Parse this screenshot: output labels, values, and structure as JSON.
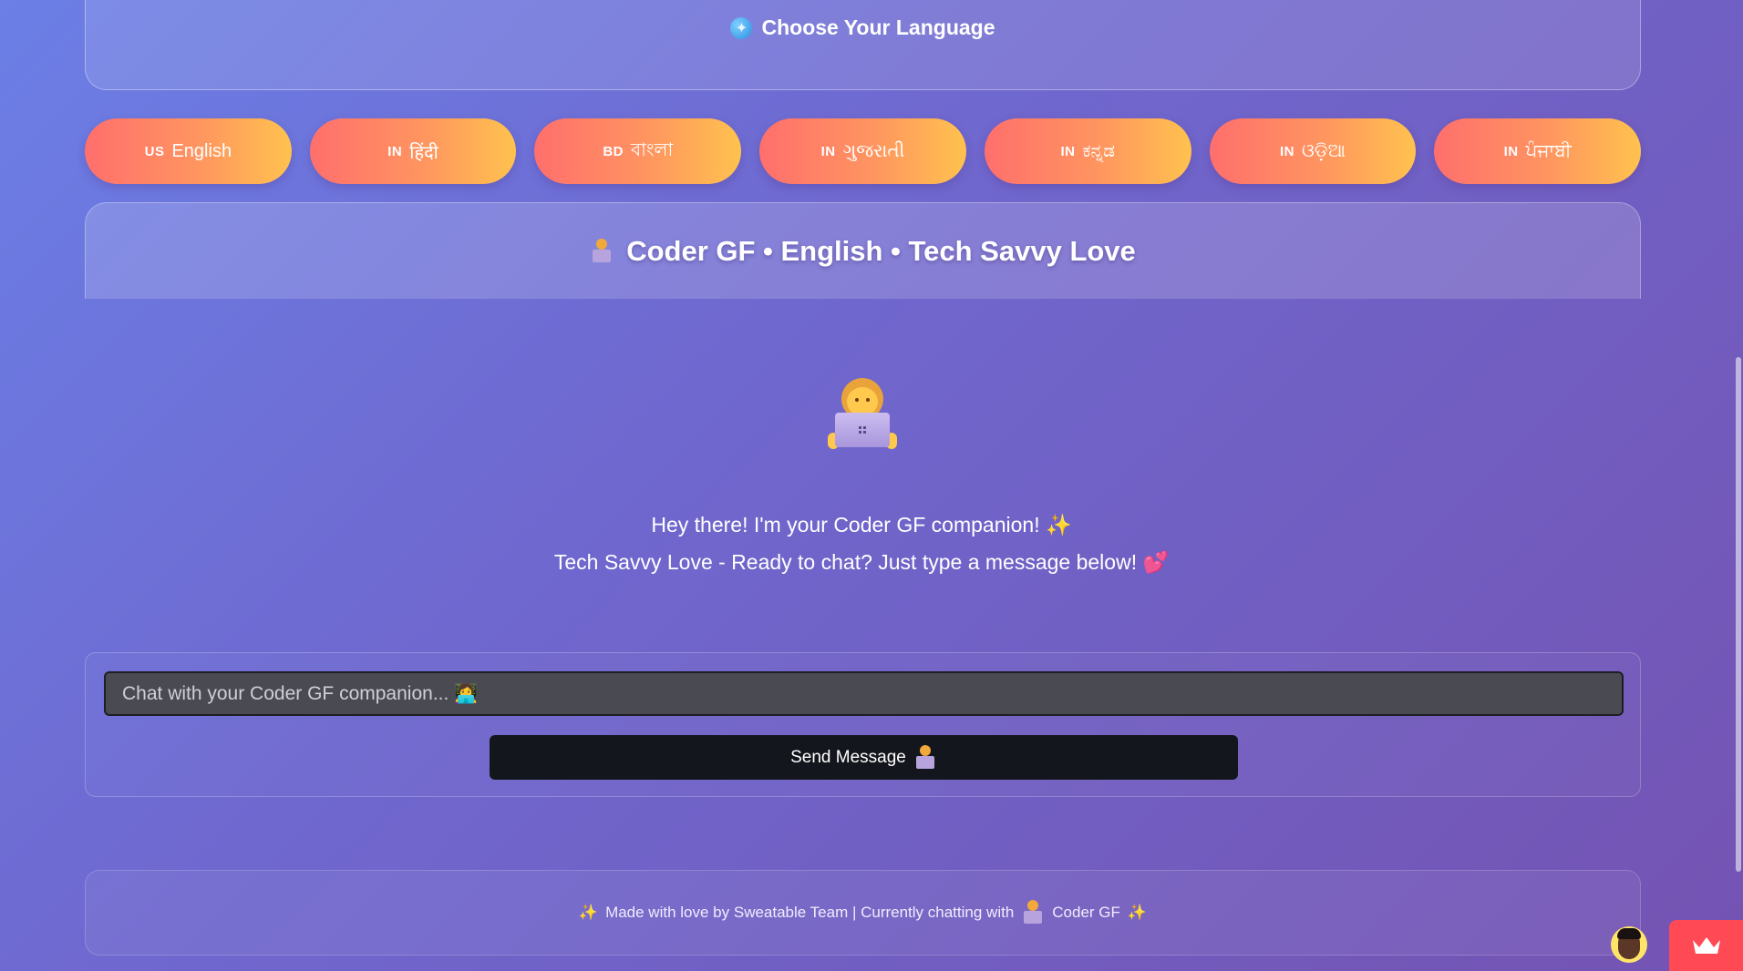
{
  "language_header": {
    "title": "Choose Your Language"
  },
  "languages": [
    {
      "flag": "US",
      "label": "English"
    },
    {
      "flag": "IN",
      "label": "हिंदी"
    },
    {
      "flag": "BD",
      "label": "বাংলা"
    },
    {
      "flag": "IN",
      "label": "ગુજરાતી"
    },
    {
      "flag": "IN",
      "label": "ಕನ್ನಡ"
    },
    {
      "flag": "IN",
      "label": "ଓଡ଼ିଆ"
    },
    {
      "flag": "IN",
      "label": "ਪੰਜਾਬੀ"
    }
  ],
  "persona": {
    "title": "Coder GF • English • Tech Savvy Love"
  },
  "welcome": {
    "line1": "Hey there! I'm your Coder GF companion!",
    "line2": "Tech Savvy Love - Ready to chat? Just type a message below!"
  },
  "chat": {
    "input_value": "",
    "placeholder": "Chat with your Coder GF companion... 👩‍💻",
    "send_label": "Send Message"
  },
  "footer": {
    "text_before": "Made with love by Sweatable Team | Currently chatting with",
    "persona_name": "Coder GF"
  },
  "icons": {
    "globe": "globe-icon",
    "coder": "woman-technologist-icon",
    "sparkles": "sparkles-icon",
    "hearts": "two-hearts-icon",
    "crown": "crown-icon"
  },
  "colors": {
    "background_start": "#6b7fe6",
    "background_end": "#7453b2",
    "language_button_start": "#ff6f6c",
    "language_button_end": "#ffc24e",
    "send_button": "#14161d",
    "input_background": "#4a4a52",
    "crown_widget": "#ff4a55"
  }
}
